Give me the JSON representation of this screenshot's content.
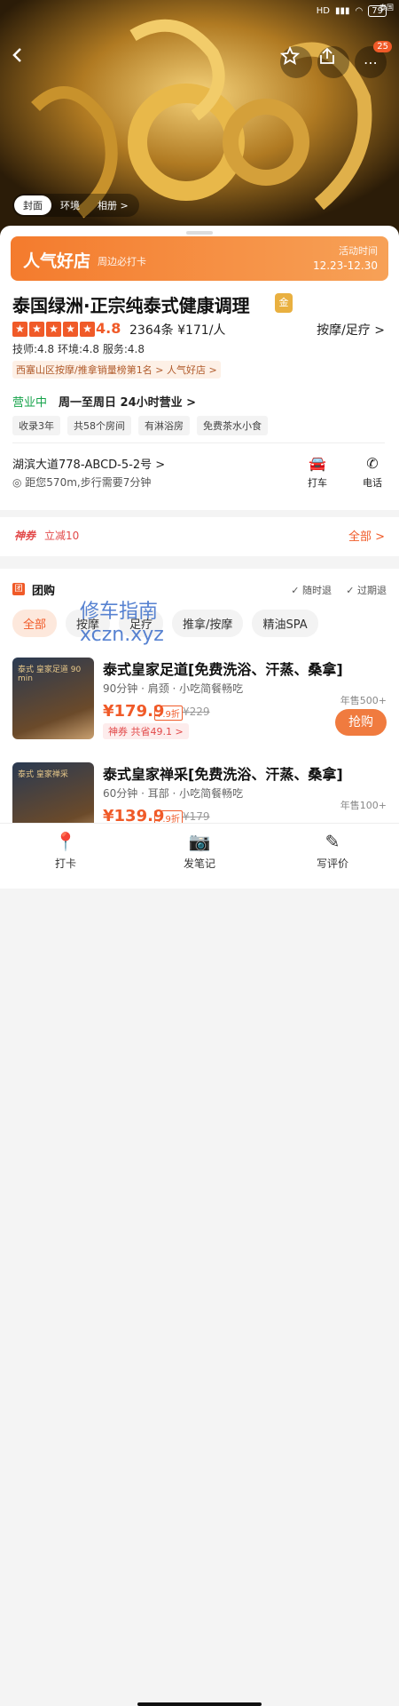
{
  "status": {
    "hd": "HD",
    "battery": "79"
  },
  "watermark_top": "泰国",
  "cart_count": "25",
  "photo_tabs": [
    "封面",
    "环境",
    "相册 >"
  ],
  "promo": {
    "title": "人气好店",
    "subtitle": "周边必打卡",
    "time_label": "活动时间",
    "time_range": "12.23-12.30"
  },
  "shop": {
    "name": "泰国绿洲·正宗纯泰式健康调理",
    "gold_label": "金",
    "rating": "4.8",
    "reviews_price": "2364条 ¥171/人",
    "category": "按摩/足疗 >",
    "sub_scores": "技师:4.8 环境:4.8 服务:4.8",
    "rank": "西塞山区按摩/推拿销量榜第1名 >",
    "hot": "人气好店 >"
  },
  "business": {
    "status": "营业中",
    "hours": "周一至周日 24小时营业 >"
  },
  "tags": [
    "收录3年",
    "共58个房间",
    "有淋浴房",
    "免费茶水小食"
  ],
  "address": {
    "street": "湖滨大道778-ABCD-5-2号 >",
    "distance": "距您570m,步行需要7分钟"
  },
  "actions": {
    "taxi": "打车",
    "phone": "电话"
  },
  "coupon": {
    "brand": "神券",
    "value": "立减10",
    "all": "全部 >"
  },
  "group": {
    "title": "团购",
    "icon_label": "团",
    "any_refund": "随时退",
    "expired_refund": "过期退",
    "filters": [
      "全部",
      "按摩",
      "足疗",
      "推拿/按摩",
      "精油SPA"
    ]
  },
  "deals": [
    {
      "name": "泰式皇家足道[免费洗浴、汗蒸、桑拿]",
      "desc": "90分钟 · 肩颈 · 小吃简餐畅吃",
      "price": "¥179.9",
      "discount": "7.9折",
      "original": "¥229",
      "save": "神券 共省49.1 >",
      "sold": "年售500+",
      "buy": "抢购",
      "thumb_text": "泰式 皇家足道 90 min"
    },
    {
      "name": "泰式皇家禅采[免费洗浴、汗蒸、桑拿]",
      "desc": "60分钟 · 耳部 · 小吃简餐畅吃",
      "price": "¥139.9",
      "discount": "7.9折",
      "original": "¥179",
      "sold": "年售100+",
      "thumb_text": "泰式 皇家禅采"
    }
  ],
  "watermark": {
    "line1": "修车指南",
    "line2": "xczn.xyz"
  },
  "bottom": {
    "checkin": "打卡",
    "note": "发笔记",
    "review": "写评价"
  }
}
